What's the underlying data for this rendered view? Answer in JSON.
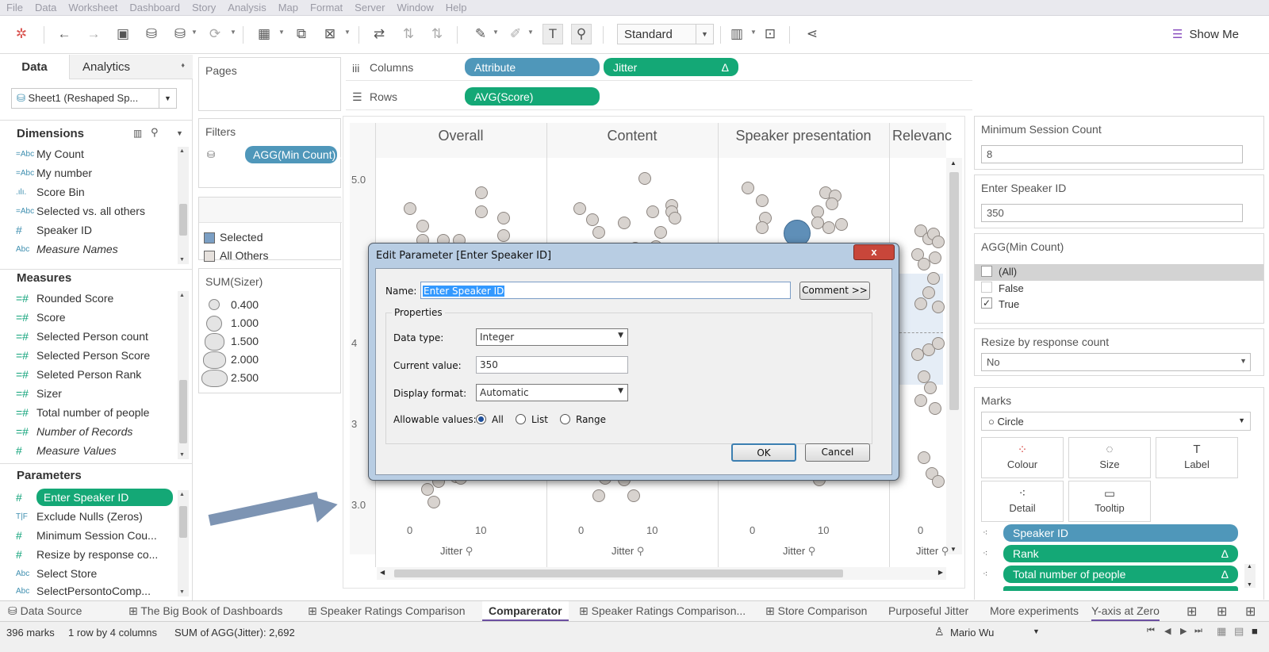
{
  "menu": [
    "File",
    "Data",
    "Worksheet",
    "Dashboard",
    "Story",
    "Analysis",
    "Map",
    "Format",
    "Server",
    "Window",
    "Help"
  ],
  "toolbar": {
    "mark_size_select": "Standard",
    "show_me": "Show Me"
  },
  "left_pane": {
    "tabs": [
      "Data",
      "Analytics"
    ],
    "datasource": "Sheet1 (Reshaped Sp...",
    "dimensions_header": "Dimensions",
    "dimensions": [
      {
        "icon": "=Abc",
        "label": "My Count"
      },
      {
        "icon": "=Abc",
        "label": "My number"
      },
      {
        "icon": ".ılı.",
        "label": "Score Bin"
      },
      {
        "icon": "=Abc",
        "label": "Selected vs. all others"
      },
      {
        "icon": "#",
        "label": "Speaker ID"
      },
      {
        "icon": "Abc",
        "label": "Measure Names"
      }
    ],
    "measures_header": "Measures",
    "measures": [
      {
        "icon": "=#",
        "label": "Rounded Score"
      },
      {
        "icon": "=#",
        "label": "Score"
      },
      {
        "icon": "=#",
        "label": "Selected Person count"
      },
      {
        "icon": "=#",
        "label": "Selected Person Score"
      },
      {
        "icon": "=#",
        "label": "Seleted Person Rank"
      },
      {
        "icon": "=#",
        "label": "Sizer"
      },
      {
        "icon": "=#",
        "label": "Total number of people"
      },
      {
        "icon": "=#",
        "label": "Number of Records"
      },
      {
        "icon": "#",
        "label": "Measure Values"
      }
    ],
    "parameters_header": "Parameters",
    "parameters": [
      {
        "icon": "#",
        "label": "Enter Speaker ID"
      },
      {
        "icon": "T|F",
        "label": "Exclude Nulls (Zeros)"
      },
      {
        "icon": "#",
        "label": "Minimum Session Cou..."
      },
      {
        "icon": "#",
        "label": "Resize by response co..."
      },
      {
        "icon": "Abc",
        "label": "Select Store"
      },
      {
        "icon": "Abc",
        "label": "SelectPersontoComp..."
      }
    ]
  },
  "shelves": {
    "pages_label": "Pages",
    "filters_label": "Filters",
    "filter_pill": "AGG(Min Count)..",
    "columns_label": "Columns",
    "rows_label": "Rows",
    "columns_pills": [
      "Attribute",
      "Jitter"
    ],
    "jitter_delta": "Δ",
    "rows_pill": "AVG(Score)"
  },
  "color_legend": {
    "items": [
      "Selected",
      "All Others"
    ],
    "colors": [
      "#7b9fc4",
      "#e6e1dd"
    ]
  },
  "size_legend": {
    "title": "SUM(Sizer)",
    "values": [
      "0.400",
      "1.000",
      "1.500",
      "2.000",
      "2.500"
    ]
  },
  "viz": {
    "columns": [
      "Overall",
      "Content",
      "Speaker presentation",
      "Relevanc"
    ],
    "y_ticks": [
      "5.0",
      "4",
      "4",
      "3",
      "3.0"
    ],
    "x_ticks": [
      "0",
      "10"
    ],
    "x_axis_label": "Jitter"
  },
  "right_pane": {
    "min_session_title": "Minimum Session Count",
    "min_session_value": "8",
    "speaker_id_title": "Enter Speaker ID",
    "speaker_id_value": "350",
    "agg_title": "AGG(Min Count)",
    "agg_options": [
      {
        "label": "(All)",
        "checked": false
      },
      {
        "label": "False",
        "checked": false
      },
      {
        "label": "True",
        "checked": true
      }
    ],
    "resize_title": "Resize by response count",
    "resize_value": "No",
    "marks_title": "Marks",
    "mark_type": "Circle",
    "mark_buttons": [
      "Colour",
      "Size",
      "Label",
      "Detail",
      "Tooltip"
    ],
    "mark_pills": [
      {
        "label": "Speaker ID",
        "delta": ""
      },
      {
        "label": "Rank",
        "delta": "Δ"
      },
      {
        "label": "Total number of people",
        "delta": "Δ"
      }
    ]
  },
  "bottom_tabs": [
    "Data Source",
    "The Big Book of Dashboards",
    "Speaker Ratings Comparison",
    "Comparerator",
    "Speaker Ratings Comparison...",
    "Store Comparison",
    "Purposeful Jitter",
    "More experiments",
    "Y-axis at Zero"
  ],
  "status": {
    "marks": "396 marks",
    "layout": "1 row by 4 columns",
    "sum": "SUM of AGG(Jitter): 2,692",
    "user": "Mario Wu"
  },
  "dialog": {
    "title": "Edit Parameter [Enter Speaker ID]",
    "close": "x",
    "name_label": "Name:",
    "name_value": "Enter Speaker ID",
    "comment_button": "Comment >>",
    "properties_label": "Properties",
    "data_type_label": "Data type:",
    "data_type_value": "Integer",
    "current_value_label": "Current value:",
    "current_value": "350",
    "display_format_label": "Display format:",
    "display_format_value": "Automatic",
    "allowable_label": "Allowable values:",
    "allowable_options": [
      "All",
      "List",
      "Range"
    ],
    "ok": "OK",
    "cancel": "Cancel"
  }
}
